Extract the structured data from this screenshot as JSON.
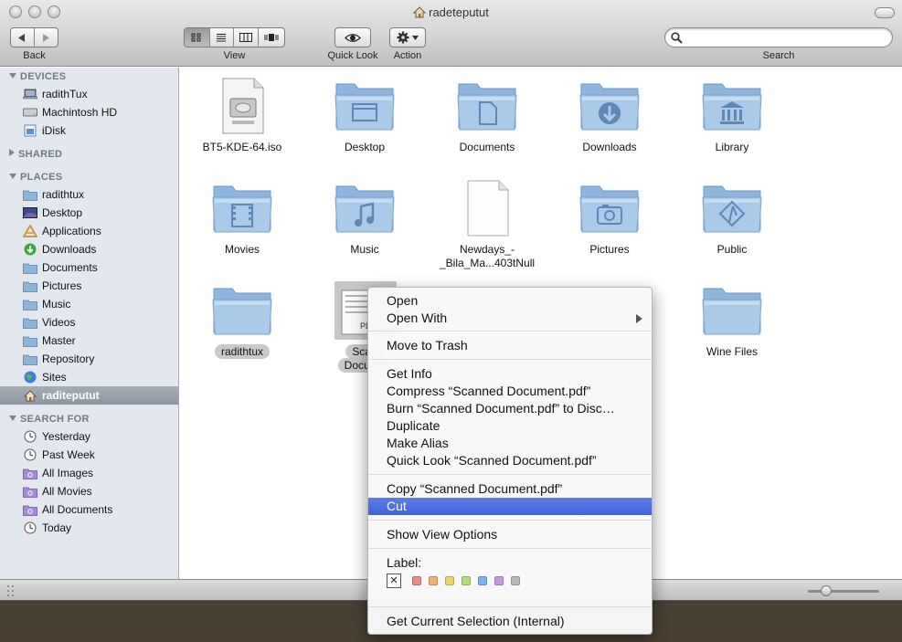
{
  "window": {
    "title": "radeteputut"
  },
  "toolbar": {
    "back_label": "Back",
    "view_label": "View",
    "quicklook_label": "Quick Look",
    "action_label": "Action",
    "search_label": "Search",
    "search_value": "",
    "search_placeholder": ""
  },
  "sidebar": {
    "devices_header": "DEVICES",
    "devices": [
      {
        "label": "radithTux",
        "icon": "laptop-icon"
      },
      {
        "label": "Machintosh HD",
        "icon": "hard-drive-icon"
      },
      {
        "label": "iDisk",
        "icon": "idisk-icon"
      }
    ],
    "shared_header": "SHARED",
    "places_header": "PLACES",
    "places": [
      {
        "label": "radithtux",
        "icon": "folder-icon"
      },
      {
        "label": "Desktop",
        "icon": "desktop-icon"
      },
      {
        "label": "Applications",
        "icon": "applications-icon"
      },
      {
        "label": "Downloads",
        "icon": "downloads-icon"
      },
      {
        "label": "Documents",
        "icon": "folder-icon"
      },
      {
        "label": "Pictures",
        "icon": "folder-icon"
      },
      {
        "label": "Music",
        "icon": "folder-icon"
      },
      {
        "label": "Videos",
        "icon": "folder-icon"
      },
      {
        "label": "Master",
        "icon": "folder-icon"
      },
      {
        "label": "Repository",
        "icon": "folder-icon"
      },
      {
        "label": "Sites",
        "icon": "globe-icon"
      },
      {
        "label": "raditeputut",
        "icon": "home-icon"
      }
    ],
    "search_header": "SEARCH FOR",
    "search_for": [
      {
        "label": "Yesterday",
        "icon": "clock-icon"
      },
      {
        "label": "Past Week",
        "icon": "clock-icon"
      },
      {
        "label": "All Images",
        "icon": "smart-folder-icon"
      },
      {
        "label": "All Movies",
        "icon": "smart-folder-icon"
      },
      {
        "label": "All Documents",
        "icon": "smart-folder-icon"
      },
      {
        "label": "Today",
        "icon": "clock-icon"
      }
    ]
  },
  "files": [
    {
      "label": "BT5-KDE-64.iso",
      "icon": "disk-image-icon"
    },
    {
      "label": "Desktop",
      "icon": "desktop-folder-icon"
    },
    {
      "label": "Documents",
      "icon": "documents-folder-icon"
    },
    {
      "label": "Downloads",
      "icon": "downloads-folder-icon"
    },
    {
      "label": "Library",
      "icon": "library-folder-icon"
    },
    {
      "label": "Movies",
      "icon": "movies-folder-icon"
    },
    {
      "label": "Music",
      "icon": "music-folder-icon"
    },
    {
      "label": "Newdays_-",
      "label2": "_Bila_Ma...403tNull",
      "icon": "blank-document-icon"
    },
    {
      "label": "Pictures",
      "icon": "pictures-folder-icon"
    },
    {
      "label": "Public",
      "icon": "public-folder-icon"
    },
    {
      "label": "radithtux",
      "icon": "folder-icon"
    },
    {
      "label": "Scan",
      "label2": "Docume",
      "icon": "pdf-document-icon"
    },
    {
      "label": "Wine Files",
      "icon": "folder-icon"
    }
  ],
  "context_menu": {
    "open": "Open",
    "open_with": "Open With",
    "move_to_trash": "Move to Trash",
    "get_info": "Get Info",
    "compress": "Compress “Scanned Document.pdf”",
    "burn": "Burn “Scanned Document.pdf” to Disc…",
    "duplicate": "Duplicate",
    "make_alias": "Make Alias",
    "quick_look": "Quick Look “Scanned Document.pdf”",
    "copy": "Copy “Scanned Document.pdf”",
    "cut": "Cut",
    "show_view_options": "Show View Options",
    "label_heading": "Label:",
    "label_none": "✕",
    "label_colors": [
      "#e88a8a",
      "#f0b070",
      "#e8d470",
      "#b4dc7a",
      "#7ab4ec",
      "#c49ae0",
      "#b8b8b8"
    ],
    "get_current_selection": "Get Current Selection (Internal)"
  },
  "colors": {
    "folder": "#9cc0e0",
    "folder_dark": "#6f9ac4",
    "highlight": "#3c63df"
  }
}
